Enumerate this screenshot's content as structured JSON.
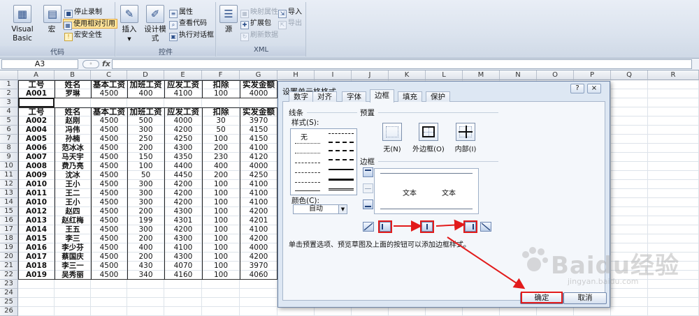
{
  "ribbon": {
    "code_group": {
      "label": "代码",
      "visual_basic": "Visual Basic",
      "macros": "宏",
      "stop_recording": "停止录制",
      "use_relative": "使用相对引用",
      "macro_security": "宏安全性"
    },
    "controls_group": {
      "label": "控件",
      "insert": "插入",
      "design_mode": "设计模式",
      "properties": "属性",
      "view_code": "查看代码",
      "run_dialog": "执行对话框"
    },
    "xml_group": {
      "label": "XML",
      "source": "源",
      "map_properties": "映射属性",
      "expansion_packs": "扩展包",
      "refresh_data": "刷新数据",
      "import": "导入",
      "export": "导出"
    }
  },
  "formula_bar": {
    "name_box": "A3",
    "fx": "fx",
    "formula": ""
  },
  "columns": [
    "A",
    "B",
    "C",
    "D",
    "E",
    "F",
    "G",
    "H",
    "I",
    "J",
    "K",
    "L",
    "M",
    "N",
    "O",
    "P",
    "Q",
    "R"
  ],
  "rows": [
    "1",
    "2",
    "3",
    "4",
    "5",
    "6",
    "7",
    "8",
    "9",
    "10",
    "11",
    "12",
    "13",
    "14",
    "15",
    "16",
    "17",
    "18",
    "19",
    "20",
    "21",
    "22",
    "23",
    "24",
    "25",
    "26"
  ],
  "table": {
    "headers": [
      "工号",
      "姓名",
      "基本工资",
      "加班工资",
      "应发工资",
      "扣除",
      "实发金额"
    ],
    "first": [
      "A001",
      "罗琳",
      "4500",
      "400",
      "4100",
      "100",
      "4000"
    ],
    "records": [
      [
        "A002",
        "赵刚",
        "4500",
        "500",
        "4000",
        "30",
        "3970"
      ],
      [
        "A004",
        "冯伟",
        "4500",
        "300",
        "4200",
        "50",
        "4150"
      ],
      [
        "A005",
        "孙楠",
        "4500",
        "250",
        "4250",
        "100",
        "4150"
      ],
      [
        "A006",
        "范冰冰",
        "4500",
        "200",
        "4300",
        "200",
        "4100"
      ],
      [
        "A007",
        "马天宇",
        "4500",
        "150",
        "4350",
        "230",
        "4120"
      ],
      [
        "A008",
        "费乃亮",
        "4500",
        "100",
        "4400",
        "400",
        "4000"
      ],
      [
        "A009",
        "沈冰",
        "4500",
        "50",
        "4450",
        "200",
        "4250"
      ],
      [
        "A010",
        "王小",
        "4500",
        "300",
        "4200",
        "100",
        "4100"
      ],
      [
        "A011",
        "王二",
        "4500",
        "300",
        "4200",
        "100",
        "4100"
      ],
      [
        "A010",
        "王小",
        "4500",
        "300",
        "4200",
        "100",
        "4100"
      ],
      [
        "A012",
        "赵四",
        "4500",
        "200",
        "4300",
        "100",
        "4200"
      ],
      [
        "A013",
        "赵红梅",
        "4500",
        "199",
        "4301",
        "100",
        "4201"
      ],
      [
        "A014",
        "王五",
        "4500",
        "300",
        "4200",
        "100",
        "4100"
      ],
      [
        "A015",
        "李三",
        "4500",
        "200",
        "4300",
        "100",
        "4200"
      ],
      [
        "A016",
        "李少芬",
        "4500",
        "400",
        "4100",
        "100",
        "4000"
      ],
      [
        "A017",
        "蔡国庆",
        "4500",
        "200",
        "4300",
        "100",
        "4200"
      ],
      [
        "A018",
        "李三一",
        "4500",
        "430",
        "4070",
        "100",
        "3970"
      ],
      [
        "A019",
        "吴秀丽",
        "4500",
        "340",
        "4160",
        "100",
        "4060"
      ]
    ]
  },
  "dialog": {
    "title": "设置单元格格式",
    "help": "?",
    "close": "×",
    "tabs": [
      "数字",
      "对齐",
      "字体",
      "边框",
      "填充",
      "保护"
    ],
    "active_tab": "边框",
    "line_section": "线条",
    "style_label": "样式(S):",
    "none_style": "无",
    "color_label": "颜色(C):",
    "color_value": "自动",
    "preset_section": "预置",
    "preset_none": "无(N)",
    "preset_outline": "外边框(O)",
    "preset_inside": "内部(I)",
    "border_section": "边框",
    "preview_text_1": "文本",
    "preview_text_2": "文本",
    "hint": "单击预置选项、预览草图及上面的按钮可以添加边框样式。",
    "ok": "确定",
    "cancel": "取消",
    "accent_color": "#e21b1b"
  },
  "watermark": {
    "brand": "Baidu经验",
    "url": "jingyan.baidu.com"
  }
}
